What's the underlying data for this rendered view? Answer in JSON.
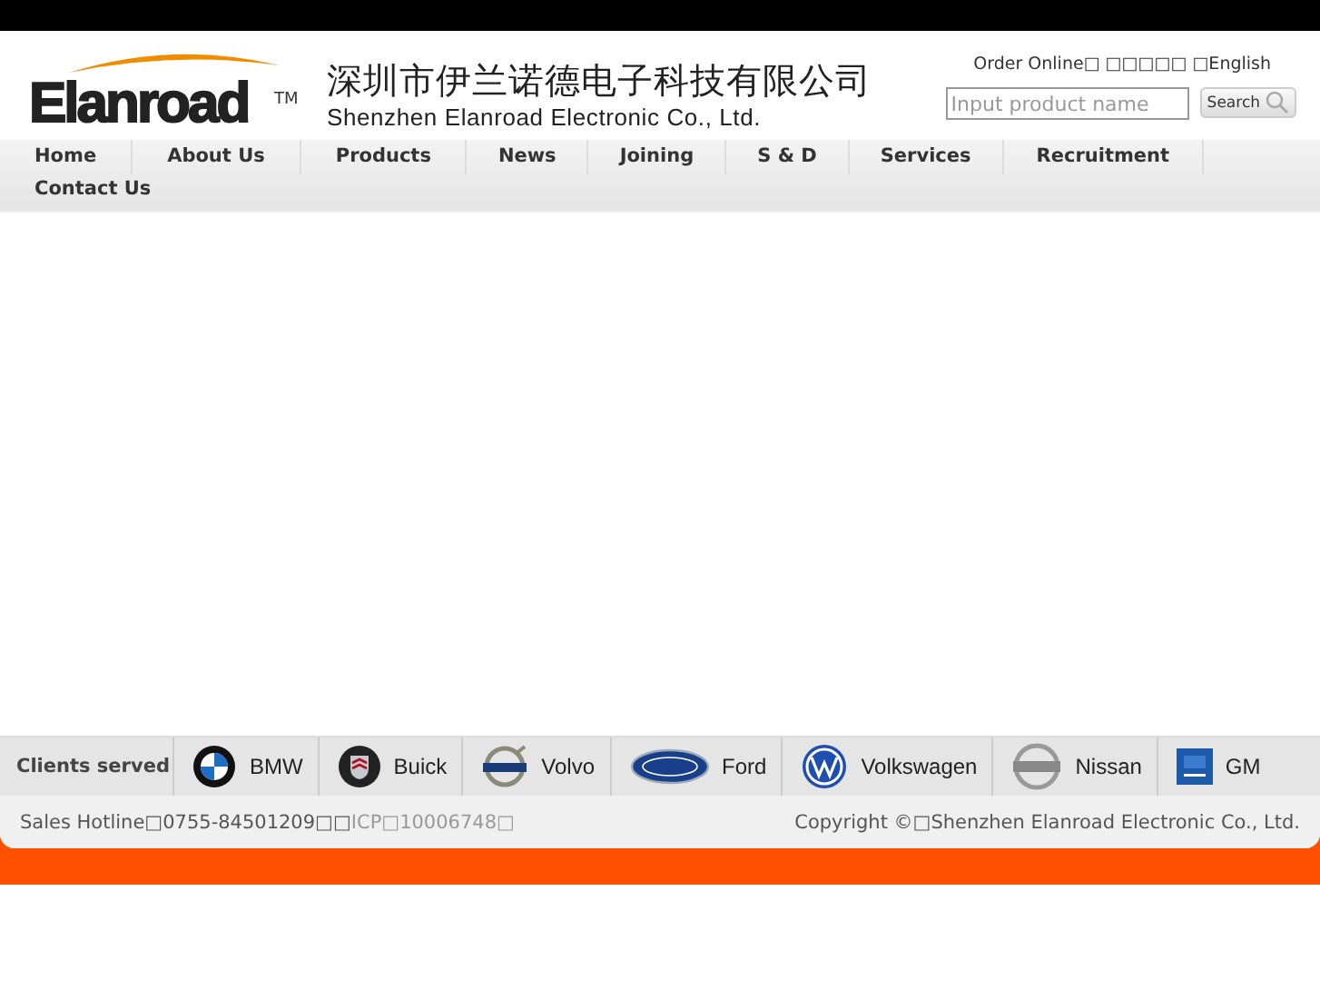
{
  "logo": {
    "name": "Elanroad",
    "mark": "TM"
  },
  "company": {
    "name_zh": "深圳市伊兰诺德电子科技有限公司",
    "name_en": "Shenzhen Elanroad Electronic Co., Ltd."
  },
  "top_links": [
    "Order Online□ □□□□□ □English"
  ],
  "search": {
    "placeholder": "Input product name",
    "button": "Search"
  },
  "nav": [
    {
      "label": "Home"
    },
    {
      "label": "About Us"
    },
    {
      "label": "Products"
    },
    {
      "label": "News"
    },
    {
      "label": "Joining"
    },
    {
      "label": "S & D"
    },
    {
      "label": "Services"
    },
    {
      "label": "Recruitment"
    },
    {
      "label": "Contact Us"
    }
  ],
  "clients": {
    "label": "Clients served",
    "items": [
      {
        "name": "BMW",
        "kind": "roundel"
      },
      {
        "name": "Buick",
        "kind": "shield"
      },
      {
        "name": "Volvo",
        "kind": "ring"
      },
      {
        "name": "Ford",
        "kind": "oval"
      },
      {
        "name": "Volkswagen",
        "kind": "vw"
      },
      {
        "name": "Nissan",
        "kind": "bar"
      },
      {
        "name": "GM",
        "kind": "square"
      }
    ]
  },
  "footer": {
    "hotline": "Sales Hotline□0755-84501209□□",
    "icp": "ICP□10006748□",
    "copyright": "Copyright ©□Shenzhen Elanroad Electronic Co., Ltd."
  }
}
